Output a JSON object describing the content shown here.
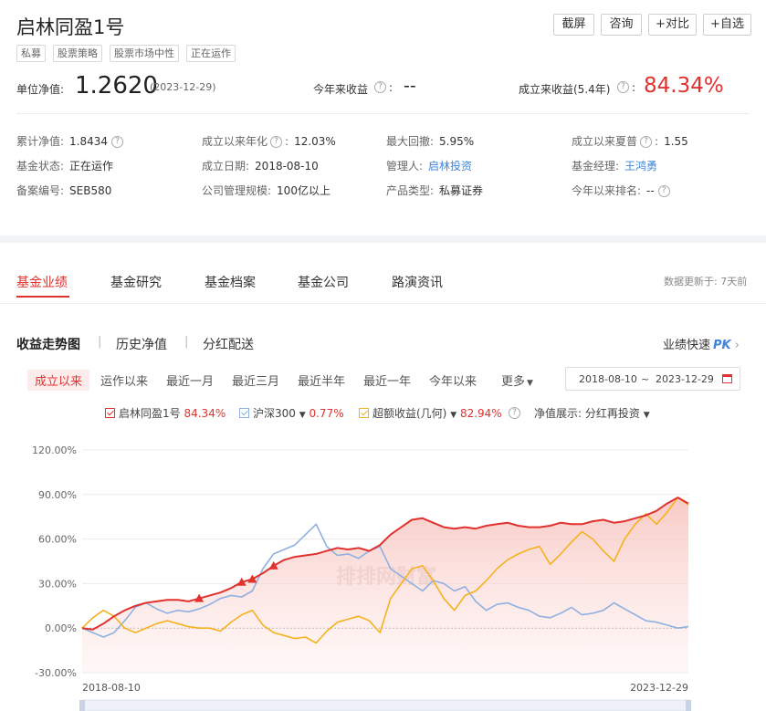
{
  "header": {
    "title": "启林同盈1号",
    "tags": [
      "私募",
      "股票策略",
      "股票市场中性",
      "正在运作"
    ],
    "buttons": [
      "截屏",
      "咨询",
      "+对比",
      "+自选"
    ]
  },
  "nav_row": {
    "label": "单位净值:",
    "value": "1.2620",
    "date": "(2023-12-29)",
    "ytd_label": "今年来收益",
    "ytd_value": "--",
    "since_label": "成立来收益(5.4年)",
    "since_value": "84.34%"
  },
  "info": [
    [
      {
        "label": "累计净值:",
        "value": "1.8434",
        "help": true
      },
      {
        "label": "成立以来年化",
        "value": "12.03%",
        "help": true
      },
      {
        "label": "最大回撤:",
        "value": "5.95%"
      },
      {
        "label": "成立以来夏普",
        "value": "1.55",
        "help": true
      }
    ],
    [
      {
        "label": "基金状态:",
        "value": "正在运作"
      },
      {
        "label": "成立日期:",
        "value": "2018-08-10"
      },
      {
        "label": "管理人:",
        "value": "启林投资",
        "link": true
      },
      {
        "label": "基金经理:",
        "value": "王鸿勇",
        "link": true
      }
    ],
    [
      {
        "label": "备案编号:",
        "value": "SEB580"
      },
      {
        "label": "公司管理规模:",
        "value": "100亿以上"
      },
      {
        "label": "产品类型:",
        "value": "私募证券"
      },
      {
        "label": "今年以来排名:",
        "value": "--",
        "help": true
      }
    ]
  ],
  "tabs": [
    "基金业绩",
    "基金研究",
    "基金档案",
    "基金公司",
    "路演资讯"
  ],
  "update_note": "数据更新于: 7天前",
  "subtabs": [
    "收益走势图",
    "历史净值",
    "分红配送"
  ],
  "pk_label": "业绩快速",
  "pk_badge": "PK",
  "periods": [
    "成立以来",
    "运作以来",
    "最近一月",
    "最近三月",
    "最近半年",
    "最近一年",
    "今年以来",
    "更多"
  ],
  "date_range": {
    "start": "2018-08-10",
    "sep": "~",
    "end": "2023-12-29"
  },
  "legend": [
    {
      "name": "启林同盈1号",
      "value": "84.34%",
      "color": "#e0322e"
    },
    {
      "name": "沪深300",
      "value": "0.77%",
      "color": "#8fb0e0"
    },
    {
      "name": "超额收益(几何)",
      "value": "82.94%",
      "color": "#f5b21e"
    }
  ],
  "nav_display": {
    "label": "净值展示:",
    "value": "分红再投资"
  },
  "watermark": "排排网财富",
  "colors": {
    "accent": "#e0322e",
    "link": "#3f86d8",
    "hs300": "#8fb0e0",
    "excess": "#f5b21e"
  },
  "chart_data": {
    "type": "line",
    "x_start": "2018-08-10",
    "x_end": "2023-12-29",
    "ylim": [
      -30,
      120
    ],
    "yticks": [
      "120.00%",
      "90.00%",
      "60.00%",
      "30.00%",
      "0.00%",
      "-30.00%"
    ],
    "series": [
      {
        "name": "启林同盈1号",
        "values": [
          0,
          -1,
          3,
          8,
          12,
          15,
          17,
          18,
          19,
          19,
          18,
          20,
          22,
          24,
          27,
          31,
          33,
          37,
          42,
          46,
          48,
          49,
          50,
          52,
          54,
          53,
          54,
          52,
          56,
          63,
          68,
          73,
          74,
          71,
          68,
          67,
          68,
          67,
          69,
          70,
          71,
          69,
          68,
          68,
          69,
          71,
          70,
          70,
          72,
          73,
          71,
          72,
          74,
          76,
          79,
          84,
          88,
          84
        ]
      },
      {
        "name": "沪深300",
        "values": [
          0,
          -3,
          -6,
          -3,
          5,
          14,
          17,
          13,
          10,
          12,
          11,
          13,
          16,
          20,
          22,
          21,
          25,
          40,
          50,
          53,
          56,
          63,
          70,
          55,
          49,
          50,
          47,
          52,
          55,
          40,
          35,
          30,
          25,
          32,
          30,
          25,
          28,
          18,
          12,
          16,
          17,
          14,
          12,
          8,
          7,
          10,
          14,
          9,
          10,
          12,
          17,
          13,
          9,
          5,
          4,
          2,
          0,
          1
        ]
      },
      {
        "name": "超额收益(几何)",
        "values": [
          0,
          7,
          12,
          8,
          0,
          -3,
          0,
          3,
          5,
          3,
          1,
          0,
          0,
          -2,
          4,
          9,
          12,
          2,
          -3,
          -5,
          -7,
          -6,
          -10,
          -2,
          4,
          6,
          8,
          5,
          -3,
          20,
          30,
          40,
          42,
          32,
          20,
          12,
          22,
          25,
          32,
          40,
          46,
          50,
          53,
          55,
          43,
          50,
          58,
          65,
          60,
          52,
          45,
          60,
          70,
          77,
          70,
          78,
          88,
          83
        ]
      }
    ],
    "markers": "dividend",
    "grid": true
  }
}
